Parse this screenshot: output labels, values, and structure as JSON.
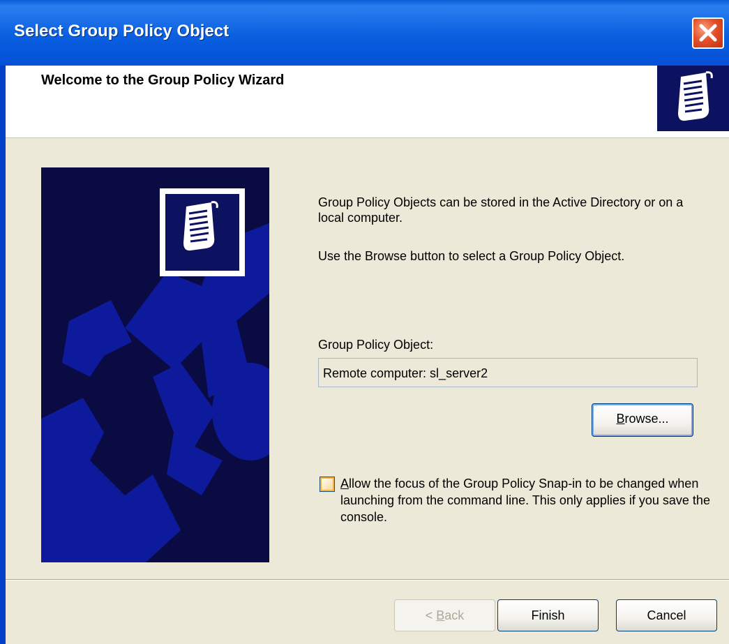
{
  "window": {
    "title": "Select Group Policy Object"
  },
  "header": {
    "heading": "Welcome to the Group Policy Wizard"
  },
  "content": {
    "intro_line1": "Group Policy Objects can be stored in the Active Directory or on a local computer.",
    "intro_line2": "Use the Browse button to select a Group Policy Object.",
    "gpo_label": "Group Policy Object:",
    "gpo_value": "Remote computer: sl_server2",
    "browse_label_accel": "B",
    "browse_label_rest": "rowse...",
    "checkbox_accel": "A",
    "checkbox_rest": "llow the focus of the Group Policy Snap-in to be changed when launching from the command line.  This only applies if you save the console.",
    "checkbox_checked": false
  },
  "footer": {
    "back_prefix": "< ",
    "back_accel": "B",
    "back_rest": "ack",
    "finish_label": "Finish",
    "cancel_label": "Cancel"
  },
  "colors": {
    "title_blue": "#0a5fd8",
    "art_navy": "#0b0b44",
    "art_blue": "#0e1a9c",
    "dialog_bg": "#ece9d8"
  }
}
